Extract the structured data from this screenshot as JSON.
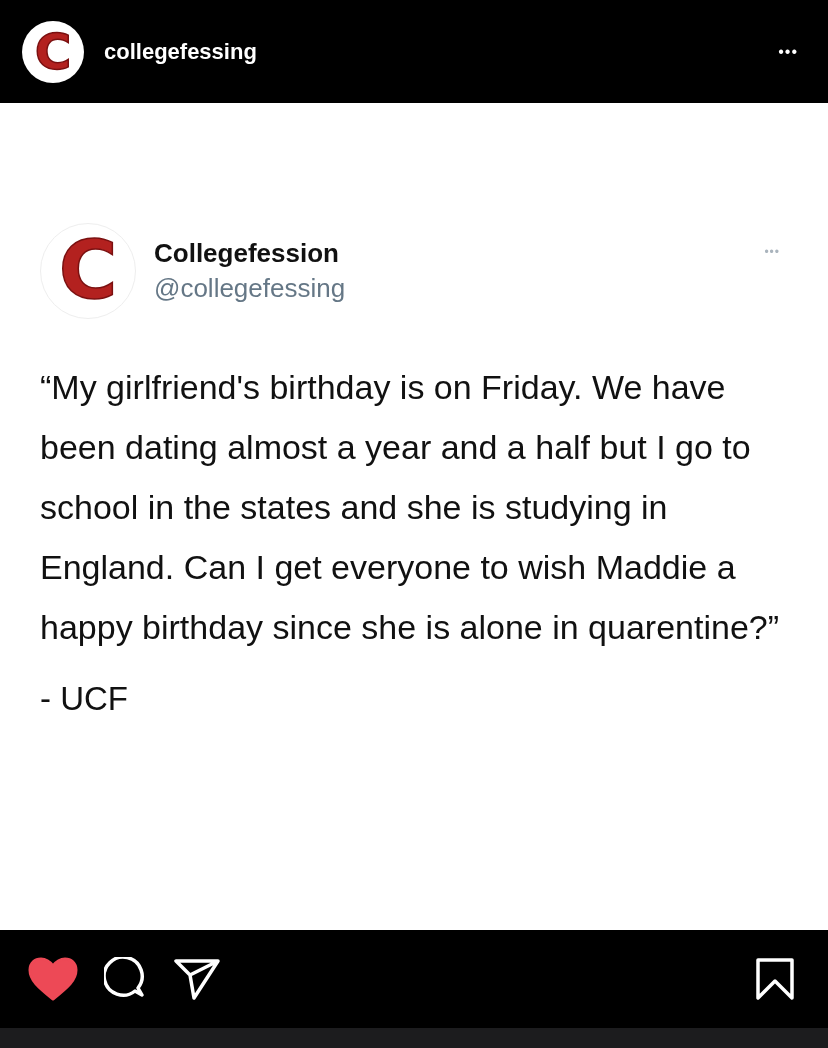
{
  "header": {
    "logo_letter": "C",
    "username": "collegefessing",
    "more": "•••"
  },
  "tweet": {
    "logo_letter": "C",
    "display_name": "Collegefession",
    "handle": "@collegefessing",
    "more": "•••",
    "text": "“My girlfriend's birthday is on Friday. We have been dating almost a year and a half but I go to school in the states and she is studying in England. Can I get everyone to wish Maddie a happy birthday since she is alone in quarentine?”",
    "signature": "- UCF"
  },
  "actions": {
    "liked": true,
    "saved": false
  }
}
